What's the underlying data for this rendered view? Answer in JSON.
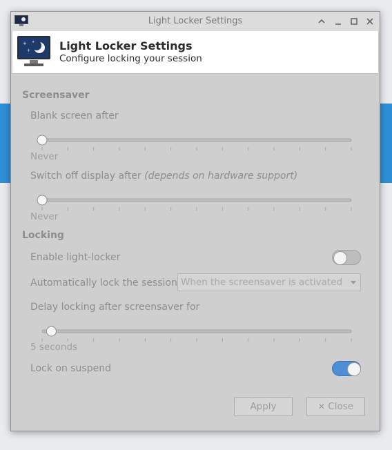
{
  "window": {
    "title": "Light Locker Settings",
    "controls": [
      "shade-icon",
      "minimize-icon",
      "maximize-icon",
      "close-icon"
    ]
  },
  "header": {
    "title": "Light Locker Settings",
    "subtitle": "Configure locking your session",
    "icon": "monitor-moon-icon"
  },
  "screensaver": {
    "heading": "Screensaver",
    "blank": {
      "label": "Blank screen after",
      "value_text": "Never",
      "position": 0
    },
    "switch_off": {
      "label": "Switch off display after",
      "note": "(depends on hardware support)",
      "value_text": "Never",
      "position": 0
    }
  },
  "locking": {
    "heading": "Locking",
    "enable": {
      "label": "Enable light-locker",
      "on": false
    },
    "auto_lock": {
      "label": "Automatically lock the session",
      "selected": "When the screensaver is activated"
    },
    "delay": {
      "label": "Delay locking after screensaver for",
      "value_text": "5 seconds",
      "position": 0.03
    },
    "suspend": {
      "label": "Lock on suspend",
      "on": true
    }
  },
  "buttons": {
    "apply": "Apply",
    "close_icon": "x-icon",
    "close": "Close"
  }
}
